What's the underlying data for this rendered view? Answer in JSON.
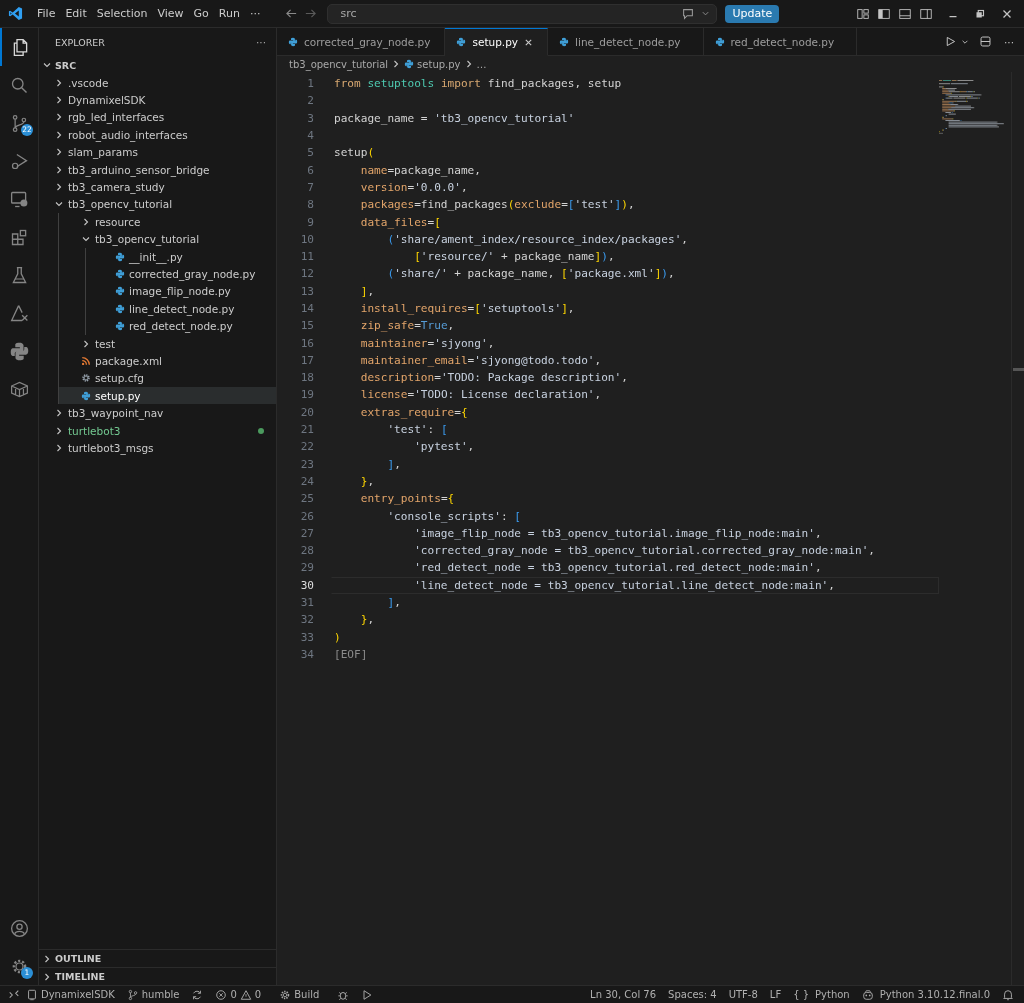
{
  "title_bar": {
    "menu": [
      "File",
      "Edit",
      "Selection",
      "View",
      "Go",
      "Run"
    ],
    "more": "···",
    "search": {
      "value": "src"
    },
    "update_button": "Update"
  },
  "activity_bar": {
    "source_control_badge": "22",
    "settings_badge": "1"
  },
  "sidebar": {
    "title": "EXPLORER",
    "more": "···",
    "root": {
      "label": "SRC",
      "expanded": true,
      "children": [
        {
          "label": ".vscode",
          "kind": "folder",
          "expanded": false,
          "selected": false,
          "modified": false
        },
        {
          "label": "DynamixelSDK",
          "kind": "folder",
          "expanded": false,
          "selected": false,
          "modified": false
        },
        {
          "label": "rgb_led_interfaces",
          "kind": "folder",
          "expanded": false,
          "selected": false,
          "modified": false
        },
        {
          "label": "robot_audio_interfaces",
          "kind": "folder",
          "expanded": false,
          "selected": false,
          "modified": false
        },
        {
          "label": "slam_params",
          "kind": "folder",
          "expanded": false,
          "selected": false,
          "modified": false
        },
        {
          "label": "tb3_arduino_sensor_bridge",
          "kind": "folder",
          "expanded": false,
          "selected": false,
          "modified": false
        },
        {
          "label": "tb3_camera_study",
          "kind": "folder",
          "expanded": false,
          "selected": false,
          "modified": false
        },
        {
          "label": "tb3_opencv_tutorial",
          "kind": "folder",
          "expanded": true,
          "selected": false,
          "modified": false,
          "children": [
            {
              "label": "resource",
              "kind": "folder",
              "expanded": false,
              "selected": false,
              "modified": false
            },
            {
              "label": "tb3_opencv_tutorial",
              "kind": "folder",
              "expanded": true,
              "selected": false,
              "modified": false,
              "children": [
                {
                  "label": "__init__.py",
                  "kind": "python",
                  "selected": false,
                  "modified": false
                },
                {
                  "label": "corrected_gray_node.py",
                  "kind": "python",
                  "selected": false,
                  "modified": false
                },
                {
                  "label": "image_flip_node.py",
                  "kind": "python",
                  "selected": false,
                  "modified": false
                },
                {
                  "label": "line_detect_node.py",
                  "kind": "python",
                  "selected": false,
                  "modified": false
                },
                {
                  "label": "red_detect_node.py",
                  "kind": "python",
                  "selected": false,
                  "modified": false
                }
              ]
            },
            {
              "label": "test",
              "kind": "folder",
              "expanded": false,
              "selected": false,
              "modified": false
            },
            {
              "label": "package.xml",
              "kind": "xml",
              "selected": false,
              "modified": false
            },
            {
              "label": "setup.cfg",
              "kind": "config",
              "selected": false,
              "modified": false
            },
            {
              "label": "setup.py",
              "kind": "python",
              "selected": true,
              "modified": false
            }
          ]
        },
        {
          "label": "tb3_waypoint_nav",
          "kind": "folder",
          "expanded": false,
          "selected": false,
          "modified": false
        },
        {
          "label": "turtlebot3",
          "kind": "folder",
          "expanded": false,
          "selected": false,
          "modified": true
        },
        {
          "label": "turtlebot3_msgs",
          "kind": "folder",
          "expanded": false,
          "selected": false,
          "modified": false
        }
      ]
    },
    "panels": [
      {
        "label": "OUTLINE",
        "expanded": false
      },
      {
        "label": "TIMELINE",
        "expanded": false
      }
    ]
  },
  "tabs": [
    {
      "label": "corrected_gray_node.py",
      "selected": false
    },
    {
      "label": "setup.py",
      "selected": true
    },
    {
      "label": "line_detect_node.py",
      "selected": false
    },
    {
      "label": "red_detect_node.py",
      "selected": false
    }
  ],
  "editor_actions_more": "···",
  "breadcrumb": {
    "folder": "tb3_opencv_tutorial",
    "file": "setup.py",
    "more": "…"
  },
  "code": [
    {
      "n": "1",
      "current": false,
      "tokens": [
        {
          "t": "from",
          "kind": "kw"
        },
        {
          "t": " setuptools",
          "kind": "mod"
        },
        {
          "t": " import",
          "kind": "kw"
        },
        {
          "t": " find_packages, setup",
          "kind": "p"
        }
      ]
    },
    {
      "n": "2",
      "current": false
    },
    {
      "n": "3",
      "current": false,
      "tokens": [
        {
          "t": "package_name =",
          "kind": "p"
        },
        {
          "t": " 'tb3_opencv_tutorial'",
          "kind": "s"
        }
      ]
    },
    {
      "n": "4",
      "current": false
    },
    {
      "n": "5",
      "current": false,
      "tokens": [
        {
          "t": "setup",
          "kind": "p"
        },
        {
          "t": "(",
          "kind": "b1"
        }
      ]
    },
    {
      "n": "6",
      "current": false,
      "tokens": [
        {
          "t": "    name",
          "kind": "a"
        },
        {
          "t": "=package_name,",
          "kind": "p"
        }
      ]
    },
    {
      "n": "7",
      "current": false,
      "tokens": [
        {
          "t": "    version",
          "kind": "a"
        },
        {
          "t": "=",
          "kind": "p"
        },
        {
          "t": "'0.0.0'",
          "kind": "s"
        },
        {
          "t": ",",
          "kind": "p"
        }
      ]
    },
    {
      "n": "8",
      "current": false,
      "tokens": [
        {
          "t": "    packages",
          "kind": "a"
        },
        {
          "t": "=find_packages",
          "kind": "p"
        },
        {
          "t": "(",
          "kind": "b1"
        },
        {
          "t": "exclude",
          "kind": "a"
        },
        {
          "t": "=",
          "kind": "p"
        },
        {
          "t": "[",
          "kind": "b2"
        },
        {
          "t": "'test'",
          "kind": "s"
        },
        {
          "t": "]",
          "kind": "b2"
        },
        {
          "t": ")",
          "kind": "b1"
        },
        {
          "t": ",",
          "kind": "p"
        }
      ]
    },
    {
      "n": "9",
      "current": false,
      "tokens": [
        {
          "t": "    data_files",
          "kind": "a"
        },
        {
          "t": "=",
          "kind": "p"
        },
        {
          "t": "[",
          "kind": "b1"
        }
      ]
    },
    {
      "n": "10",
      "current": false,
      "tokens": [
        {
          "t": "        (",
          "kind": "b2"
        },
        {
          "t": "'share/ament_index/resource_index/packages'",
          "kind": "s"
        },
        {
          "t": ",",
          "kind": "p"
        }
      ]
    },
    {
      "n": "11",
      "current": false,
      "tokens": [
        {
          "t": "            [",
          "kind": "b1"
        },
        {
          "t": "'resource/'",
          "kind": "s"
        },
        {
          "t": " + package_name",
          "kind": "p"
        },
        {
          "t": "]",
          "kind": "b1"
        },
        {
          "t": ")",
          "kind": "b2"
        },
        {
          "t": ",",
          "kind": "p"
        }
      ]
    },
    {
      "n": "12",
      "current": false,
      "tokens": [
        {
          "t": "        (",
          "kind": "b2"
        },
        {
          "t": "'share/'",
          "kind": "s"
        },
        {
          "t": " + package_name,",
          "kind": "p"
        },
        {
          "t": " [",
          "kind": "b1"
        },
        {
          "t": "'package.xml'",
          "kind": "s"
        },
        {
          "t": "]",
          "kind": "b1"
        },
        {
          "t": ")",
          "kind": "b2"
        },
        {
          "t": ",",
          "kind": "p"
        }
      ]
    },
    {
      "n": "13",
      "current": false,
      "tokens": [
        {
          "t": "    ]",
          "kind": "b1"
        },
        {
          "t": ",",
          "kind": "p"
        }
      ]
    },
    {
      "n": "14",
      "current": false,
      "tokens": [
        {
          "t": "    install_requires",
          "kind": "a"
        },
        {
          "t": "=",
          "kind": "p"
        },
        {
          "t": "[",
          "kind": "b1"
        },
        {
          "t": "'setuptools'",
          "kind": "s"
        },
        {
          "t": "]",
          "kind": "b1"
        },
        {
          "t": ",",
          "kind": "p"
        }
      ]
    },
    {
      "n": "15",
      "current": false,
      "tokens": [
        {
          "t": "    zip_safe",
          "kind": "a"
        },
        {
          "t": "=",
          "kind": "p"
        },
        {
          "t": "True",
          "kind": "c"
        },
        {
          "t": ",",
          "kind": "p"
        }
      ]
    },
    {
      "n": "16",
      "current": false,
      "tokens": [
        {
          "t": "    maintainer",
          "kind": "a"
        },
        {
          "t": "=",
          "kind": "p"
        },
        {
          "t": "'sjyong'",
          "kind": "s"
        },
        {
          "t": ",",
          "kind": "p"
        }
      ]
    },
    {
      "n": "17",
      "current": false,
      "tokens": [
        {
          "t": "    maintainer_email",
          "kind": "a"
        },
        {
          "t": "=",
          "kind": "p"
        },
        {
          "t": "'sjyong@todo.todo'",
          "kind": "s"
        },
        {
          "t": ",",
          "kind": "p"
        }
      ]
    },
    {
      "n": "18",
      "current": false,
      "tokens": [
        {
          "t": "    description",
          "kind": "a"
        },
        {
          "t": "=",
          "kind": "p"
        },
        {
          "t": "'TODO: Package description'",
          "kind": "s"
        },
        {
          "t": ",",
          "kind": "p"
        }
      ]
    },
    {
      "n": "19",
      "current": false,
      "tokens": [
        {
          "t": "    license",
          "kind": "a"
        },
        {
          "t": "=",
          "kind": "p"
        },
        {
          "t": "'TODO: License declaration'",
          "kind": "s"
        },
        {
          "t": ",",
          "kind": "p"
        }
      ]
    },
    {
      "n": "20",
      "current": false,
      "tokens": [
        {
          "t": "    extras_require",
          "kind": "a"
        },
        {
          "t": "=",
          "kind": "p"
        },
        {
          "t": "{",
          "kind": "b1"
        }
      ]
    },
    {
      "n": "21",
      "current": false,
      "tokens": [
        {
          "t": "        'test'",
          "kind": "s"
        },
        {
          "t": ":",
          "kind": "p"
        },
        {
          "t": " [",
          "kind": "b2"
        }
      ]
    },
    {
      "n": "22",
      "current": false,
      "tokens": [
        {
          "t": "            'pytest'",
          "kind": "s"
        },
        {
          "t": ",",
          "kind": "p"
        }
      ]
    },
    {
      "n": "23",
      "current": false,
      "tokens": [
        {
          "t": "        ]",
          "kind": "b2"
        },
        {
          "t": ",",
          "kind": "p"
        }
      ]
    },
    {
      "n": "24",
      "current": false,
      "tokens": [
        {
          "t": "    }",
          "kind": "b1"
        },
        {
          "t": ",",
          "kind": "p"
        }
      ]
    },
    {
      "n": "25",
      "current": false,
      "tokens": [
        {
          "t": "    entry_points",
          "kind": "a"
        },
        {
          "t": "=",
          "kind": "p"
        },
        {
          "t": "{",
          "kind": "b1"
        }
      ]
    },
    {
      "n": "26",
      "current": false,
      "tokens": [
        {
          "t": "        'console_scripts'",
          "kind": "s"
        },
        {
          "t": ":",
          "kind": "p"
        },
        {
          "t": " [",
          "kind": "b2"
        }
      ]
    },
    {
      "n": "27",
      "current": false,
      "tokens": [
        {
          "t": "            'image_flip_node = tb3_opencv_tutorial.image_flip_node:main'",
          "kind": "s"
        },
        {
          "t": ",",
          "kind": "p"
        }
      ]
    },
    {
      "n": "28",
      "current": false,
      "tokens": [
        {
          "t": "            'corrected_gray_node = tb3_opencv_tutorial.corrected_gray_node:main'",
          "kind": "s"
        },
        {
          "t": ",",
          "kind": "p"
        }
      ]
    },
    {
      "n": "29",
      "current": false,
      "tokens": [
        {
          "t": "            'red_detect_node = tb3_opencv_tutorial.red_detect_node:main'",
          "kind": "s"
        },
        {
          "t": ",",
          "kind": "p"
        }
      ]
    },
    {
      "n": "30",
      "current": true,
      "tokens": [
        {
          "t": "            'line_detect_node = tb3_opencv_tutorial.line_detect_node:main'",
          "kind": "s"
        },
        {
          "t": ",",
          "kind": "p"
        }
      ]
    },
    {
      "n": "31",
      "current": false,
      "tokens": [
        {
          "t": "        ]",
          "kind": "b2"
        },
        {
          "t": ",",
          "kind": "p"
        }
      ]
    },
    {
      "n": "32",
      "current": false,
      "tokens": [
        {
          "t": "    }",
          "kind": "b1"
        },
        {
          "t": ",",
          "kind": "p"
        }
      ]
    },
    {
      "n": "33",
      "current": false,
      "tokens": [
        {
          "t": ")",
          "kind": "b1"
        }
      ]
    },
    {
      "n": "34",
      "current": false,
      "tokens": [
        {
          "t": "[EOF]",
          "kind": "eof"
        }
      ]
    }
  ],
  "status_bar": {
    "project": "DynamixelSDK",
    "branch": "humble",
    "errors": "0",
    "warnings": "0",
    "task": "Build",
    "position": "Ln 30, Col 76",
    "indentation": "Spaces: 4",
    "encoding": "UTF-8",
    "eol": "LF",
    "language_icon": "{ }",
    "language": "Python",
    "interpreter": "Python 3.10.12.final.0"
  }
}
